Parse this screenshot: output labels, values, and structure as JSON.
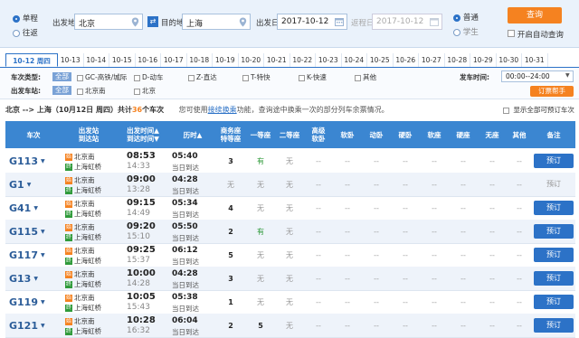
{
  "search": {
    "trip_one_way": "单程",
    "trip_round": "往返",
    "from_label": "出发地",
    "from_value": "北京",
    "to_label": "目的地",
    "to_value": "上海",
    "depart_label": "出发日",
    "depart_value": "2017-10-12",
    "return_label": "返程日",
    "return_value": "2017-10-12",
    "ptype_normal": "普通",
    "ptype_student": "学生",
    "query_btn": "查询",
    "auto_query": "开启自动查询"
  },
  "dates": [
    {
      "label": "10-12 周四",
      "active": true
    },
    {
      "label": "10-13"
    },
    {
      "label": "10-14"
    },
    {
      "label": "10-15"
    },
    {
      "label": "10-16"
    },
    {
      "label": "10-17"
    },
    {
      "label": "10-18"
    },
    {
      "label": "10-19"
    },
    {
      "label": "10-20"
    },
    {
      "label": "10-21"
    },
    {
      "label": "10-22"
    },
    {
      "label": "10-23"
    },
    {
      "label": "10-24"
    },
    {
      "label": "10-25"
    },
    {
      "label": "10-26"
    },
    {
      "label": "10-27"
    },
    {
      "label": "10-28"
    },
    {
      "label": "10-29"
    },
    {
      "label": "10-30"
    },
    {
      "label": "10-31"
    }
  ],
  "filters": {
    "type_label": "车次类型:",
    "type_all": "全部",
    "types": [
      "GC-高铁/城际",
      "D-动车",
      "Z-直达",
      "T-特快",
      "K-快速",
      "其他"
    ],
    "station_label": "出发车站:",
    "station_all": "全部",
    "stations": [
      "北京南",
      "北京"
    ],
    "time_label": "发车时间:",
    "time_value": "00:00--24:00",
    "pref_btn": "订票帮手"
  },
  "summary": {
    "route": "北京 --> 上海（10月12日 周四）共计",
    "count": "36",
    "suffix": "个车次",
    "tip_pre": "您可使用",
    "tip_link": "接续换乘",
    "tip_post": "功能，查询途中换乘一次的部分列车余票情况。",
    "show_all": "显示全部可预订车次"
  },
  "headers": {
    "train": "车次",
    "stations": "出发站\n到达站",
    "times": "出发时间▲\n到达时间▼",
    "dur": "历时▲",
    "biz": "商务座\n特等座",
    "first": "一等座",
    "second": "二等座",
    "soft_high": "高级\n软卧",
    "soft": "软卧",
    "dong": "动卧",
    "hard": "硬卧",
    "soft_seat": "软座",
    "hard_seat": "硬座",
    "none": "无座",
    "other": "其他",
    "note": "备注"
  },
  "badges": {
    "start": "始",
    "end": "终"
  },
  "rows": [
    {
      "no": "G113",
      "from": "北京南",
      "to": "上海虹桥",
      "dep": "08:53",
      "arr": "14:33",
      "dur": "05:40",
      "day": "当日到达",
      "biz": "3",
      "first": "有",
      "second": "无",
      "others": [
        "--",
        "--",
        "--",
        "--",
        "--",
        "--",
        "--",
        "--",
        "--"
      ],
      "book": "预订",
      "bookable": true
    },
    {
      "no": "G1",
      "from": "北京南",
      "to": "上海虹桥",
      "dep": "09:00",
      "arr": "13:28",
      "dur": "04:28",
      "day": "当日到达",
      "biz": "无",
      "first": "无",
      "second": "无",
      "others": [
        "--",
        "--",
        "--",
        "--",
        "--",
        "--",
        "--",
        "--",
        "--"
      ],
      "book": "预订",
      "bookable": false
    },
    {
      "no": "G41",
      "from": "北京南",
      "to": "上海虹桥",
      "dep": "09:15",
      "arr": "14:49",
      "dur": "05:34",
      "day": "当日到达",
      "biz": "4",
      "first": "无",
      "second": "无",
      "others": [
        "--",
        "--",
        "--",
        "--",
        "--",
        "--",
        "--",
        "--",
        "--"
      ],
      "book": "预订",
      "bookable": true
    },
    {
      "no": "G115",
      "from": "北京南",
      "to": "上海虹桥",
      "dep": "09:20",
      "arr": "15:10",
      "dur": "05:50",
      "day": "当日到达",
      "biz": "2",
      "first": "有",
      "second": "无",
      "others": [
        "--",
        "--",
        "--",
        "--",
        "--",
        "--",
        "--",
        "--",
        "--"
      ],
      "book": "预订",
      "bookable": true
    },
    {
      "no": "G117",
      "from": "北京南",
      "to": "上海虹桥",
      "dep": "09:25",
      "arr": "15:37",
      "dur": "06:12",
      "day": "当日到达",
      "biz": "5",
      "first": "无",
      "second": "无",
      "others": [
        "--",
        "--",
        "--",
        "--",
        "--",
        "--",
        "--",
        "--",
        "--"
      ],
      "book": "预订",
      "bookable": true
    },
    {
      "no": "G13",
      "from": "北京南",
      "to": "上海虹桥",
      "dep": "10:00",
      "arr": "14:28",
      "dur": "04:28",
      "day": "当日到达",
      "biz": "3",
      "first": "无",
      "second": "无",
      "others": [
        "--",
        "--",
        "--",
        "--",
        "--",
        "--",
        "--",
        "--",
        "--"
      ],
      "book": "预订",
      "bookable": true
    },
    {
      "no": "G119",
      "from": "北京南",
      "to": "上海虹桥",
      "dep": "10:05",
      "arr": "15:43",
      "dur": "05:38",
      "day": "当日到达",
      "biz": "1",
      "first": "无",
      "second": "无",
      "others": [
        "--",
        "--",
        "--",
        "--",
        "--",
        "--",
        "--",
        "--",
        "--"
      ],
      "book": "预订",
      "bookable": true
    },
    {
      "no": "G121",
      "from": "北京南",
      "to": "上海虹桥",
      "dep": "10:28",
      "arr": "16:32",
      "dur": "06:04",
      "day": "当日到达",
      "biz": "2",
      "first": "5",
      "second": "无",
      "others": [
        "--",
        "--",
        "--",
        "--",
        "--",
        "--",
        "--",
        "--",
        "--"
      ],
      "book": "预订",
      "bookable": true
    }
  ],
  "colors": {
    "accent": "#2c72c7",
    "header": "#3b86d1",
    "orange": "#f58220",
    "green": "#2f9a3a"
  }
}
